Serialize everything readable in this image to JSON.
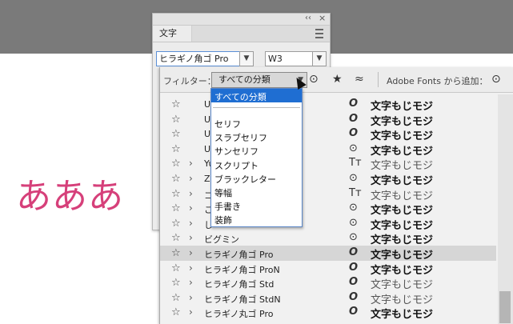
{
  "document": {
    "sample_text": "あああ"
  },
  "panel": {
    "tab_label": "文字",
    "font_family_value": "ヒラギノ角ゴ Pro",
    "font_style_value": "W3"
  },
  "toolbar": {
    "filter_label": "フィルター：",
    "filter_value": "すべての分類",
    "add_fonts_label": "Adobe Fonts から追加："
  },
  "dropdown": {
    "options": [
      "すべての分類",
      "セリフ",
      "スラブセリフ",
      "サンセリフ",
      "スクリプト",
      "ブラックレター",
      "等幅",
      "手書き",
      "装飾"
    ],
    "selected": "すべての分類"
  },
  "font_rows": [
    {
      "name": "UD",
      "type_icon": "opentype-icon",
      "sample": "文字もじモジ",
      "weight": "bold"
    },
    {
      "name": "UD",
      "type_icon": "opentype-icon",
      "sample": "文字もじモジ",
      "weight": "bold"
    },
    {
      "name": "UD",
      "type_icon": "opentype-icon",
      "sample": "文字もじモジ",
      "weight": "bold"
    },
    {
      "name": "UD",
      "type_icon": "adobe-fonts-icon",
      "sample": "文字もじモジ",
      "weight": "bold"
    },
    {
      "name": "Yu",
      "type_icon": "truetype-icon",
      "sample": "文字もじモジ",
      "weight": "light"
    },
    {
      "name": "Ze",
      "type_icon": "adobe-fonts-icon",
      "sample": "文字もじモジ",
      "weight": "bold"
    },
    {
      "name": "コ",
      "type_icon": "truetype-icon",
      "sample": "文字もじモジ",
      "weight": "light"
    },
    {
      "name": "こ",
      "type_icon": "adobe-fonts-icon",
      "sample": "文字もじモジ",
      "weight": "bold"
    },
    {
      "name": "し",
      "type_icon": "adobe-fonts-icon",
      "sample": "文字もじモジ",
      "weight": "bold"
    },
    {
      "name": "ビグミン",
      "type_icon": "adobe-fonts-icon",
      "sample": "文字もじモジ",
      "weight": "bold"
    },
    {
      "name": "ヒラギノ角ゴ Pro",
      "type_icon": "opentype-icon",
      "sample": "文字もじモジ",
      "weight": "bold",
      "selected": true
    },
    {
      "name": "ヒラギノ角ゴ ProN",
      "type_icon": "opentype-icon",
      "sample": "文字もじモジ",
      "weight": "bold"
    },
    {
      "name": "ヒラギノ角ゴ Std",
      "type_icon": "opentype-icon",
      "sample": "文字もじモジ",
      "weight": "light"
    },
    {
      "name": "ヒラギノ角ゴ StdN",
      "type_icon": "opentype-icon",
      "sample": "文字もじモジ",
      "weight": "light"
    },
    {
      "name": "ヒラギノ丸ゴ Pro",
      "type_icon": "opentype-icon",
      "sample": "文字もじモジ",
      "weight": "bold"
    }
  ],
  "icons": {
    "opentype": "O",
    "truetype": "Tт",
    "adobe": "⊙"
  }
}
